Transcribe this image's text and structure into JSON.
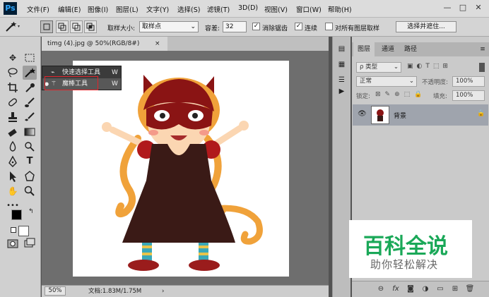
{
  "app": {
    "logo": "Ps"
  },
  "menu": [
    "文件(F)",
    "编辑(E)",
    "图像(I)",
    "图层(L)",
    "文字(Y)",
    "选择(S)",
    "滤镜(T)",
    "3D(D)",
    "视图(V)",
    "窗口(W)",
    "帮助(H)"
  ],
  "window_controls": {
    "minimize": "—",
    "maximize": "□",
    "close": "✕"
  },
  "options_bar": {
    "sample_size_label": "取样大小:",
    "sample_size_value": "取样点",
    "tolerance_label": "容差:",
    "tolerance_value": "32",
    "antialias_label": "消除锯齿",
    "antialias_checked": true,
    "contiguous_label": "连续",
    "contiguous_checked": true,
    "all_layers_label": "对所有图层取样",
    "all_layers_checked": false,
    "select_mask_button": "选择并遮住..."
  },
  "document": {
    "tab_title": "timg (4).jpg @ 50%(RGB/8#)",
    "tab_close": "×",
    "zoom": "50%",
    "doc_info": "文档:1.83M/1.75M"
  },
  "flyout": {
    "items": [
      {
        "label": "快速选择工具",
        "shortcut": "W",
        "selected": false
      },
      {
        "label": "魔棒工具",
        "shortcut": "W",
        "selected": true
      }
    ]
  },
  "layers_panel": {
    "tabs": [
      "图层",
      "通道",
      "路径"
    ],
    "active_tab": "图层",
    "filter_kind": "ρ 类型",
    "blend_mode": "正常",
    "opacity_label": "不透明度:",
    "opacity_value": "100%",
    "lock_label": "锁定:",
    "fill_label": "填充:",
    "fill_value": "100%",
    "layers": [
      {
        "name": "背景",
        "visible": true,
        "locked": true
      }
    ]
  },
  "watermark": {
    "title": "百科全说",
    "subtitle": "助你轻松解决"
  },
  "colors": {
    "menubar_bg": "#dcdcdc",
    "panel_bg": "#cacaca",
    "canvas_bg": "#6e6e6e",
    "highlight_red": "#e0242b",
    "watermark_green": "#1aa858",
    "foreground_color": "#000000",
    "background_color": "#ffffff"
  },
  "icons": {
    "toolbar": [
      "move-icon",
      "marquee-icon",
      "lasso-icon",
      "magic-wand-icon",
      "crop-icon",
      "eyedropper-icon",
      "healing-brush-icon",
      "brush-icon",
      "clone-stamp-icon",
      "history-brush-icon",
      "eraser-icon",
      "gradient-icon",
      "blur-icon",
      "dodge-icon",
      "pen-icon",
      "type-icon",
      "path-select-icon",
      "shape-icon",
      "hand-icon",
      "zoom-icon",
      "more-tools-icon",
      "quick-mask-icon",
      "screen-mode-icon"
    ]
  }
}
